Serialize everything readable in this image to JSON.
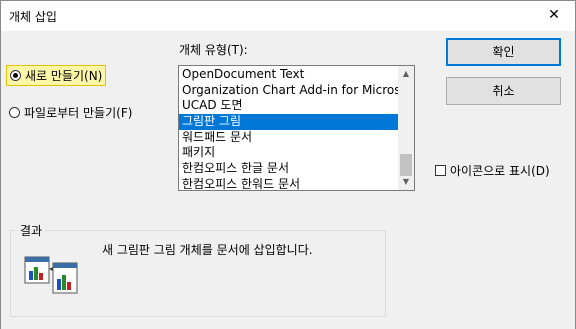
{
  "title": "개체 삽입",
  "radio_new": "새로 만들기(N)",
  "radio_file": "파일로부터 만들기(F)",
  "object_type_label": "개체 유형(T):",
  "object_types": [
    "OpenDocument Text",
    "Organization Chart Add-in for Microsoft",
    "UCAD 도면",
    "그림판 그림",
    "워드패드 문서",
    "패키지",
    "한컴오피스 한글 문서",
    "한컴오피스 한워드 문서"
  ],
  "selected_type": "그림판 그림",
  "ok_button": "확인",
  "cancel_button": "취소",
  "display_as_icon": "아이콘으로 표시(D)",
  "result_label": "결과",
  "result_text": "새 그림판 그림 개체를 문서에 삽입합니다.",
  "colors": {
    "selection": "#0078d7",
    "focus_highlight": "#fff7a8",
    "dialog_bg": "#f0f0f0"
  }
}
